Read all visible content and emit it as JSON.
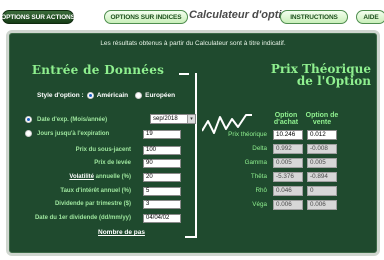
{
  "tabs": {
    "actions": "OPTIONS SUR ACTIONS",
    "indices": "OPTIONS SUR INDICES",
    "title": "Calculateur d'options",
    "instructions": "INSTRUCTIONS",
    "aide": "AIDE"
  },
  "intro": "Les résultats obtenus à partir du Calculateur sont à titre indicatif.",
  "entree_heading": "Entrée de Données",
  "prix_heading_line1": "Prix Théorique",
  "prix_heading_line2": "de l'Option",
  "style": {
    "label": "Style d'option :",
    "opt1": "Américain",
    "opt2": "Européen",
    "selected": "Américain"
  },
  "fields": {
    "date_exp_label": "Date d'exp. (Mois/année)",
    "date_exp_value": "sep/2018",
    "jours_label": "Jours jusqu'à l'expiration",
    "jours_value": "19",
    "prix_sous_label": "Prix du sous-jacent",
    "prix_sous_value": "100",
    "prix_levee_label": "Prix de levée",
    "prix_levee_value": "90",
    "volatilite_label": "Volatilité",
    "volatilite_suffix": " annuelle (%)",
    "volatilite_value": "20",
    "taux_label": "Taux d'intérêt annuel (%)",
    "taux_value": "5",
    "dividende_label": "Dividende par trimestre ($)",
    "dividende_value": "3",
    "date_div_label": "Date du 1er dividende (dd/mm/yy)",
    "date_div_value": "04/04/02"
  },
  "nombre_de_pas": "Nombre de pas",
  "results": {
    "col_achat": "Option d'achat",
    "col_vente": "Option de vente",
    "rows": [
      {
        "label": "Prix théorique",
        "achat": "10.246",
        "vente": "0.012"
      },
      {
        "label": "Delta",
        "achat": "0.992",
        "vente": "-0.008"
      },
      {
        "label": "Gamma",
        "achat": "0.005",
        "vente": "0.005"
      },
      {
        "label": "Thêta",
        "achat": "-5.376",
        "vente": "-0.894"
      },
      {
        "label": "Rhô",
        "achat": "0.046",
        "vente": "0"
      },
      {
        "label": "Véga",
        "achat": "0.006",
        "vente": "0.006"
      }
    ]
  },
  "colors": {
    "panel": "#1f4a2e",
    "heading": "#8ff08f",
    "label": "#9fe79f"
  }
}
